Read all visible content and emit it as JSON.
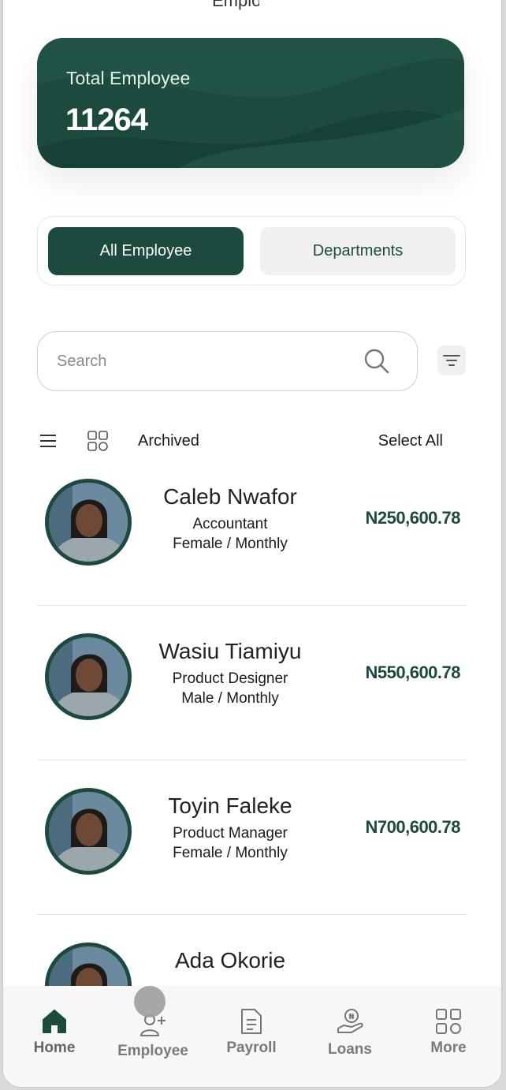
{
  "header": {
    "title_fragment": "Employee"
  },
  "total_card": {
    "label": "Total Employee",
    "value": "11264"
  },
  "tabs": [
    {
      "label": "All Employee",
      "active": true
    },
    {
      "label": "Departments",
      "active": false
    }
  ],
  "search": {
    "placeholder": "Search"
  },
  "view_bar": {
    "archived_label": "Archived",
    "select_all_label": "Select All"
  },
  "employees": [
    {
      "name": "Caleb Nwafor",
      "role": "Accountant",
      "meta": "Female / Monthly",
      "salary": "N250,600.78"
    },
    {
      "name": "Wasiu Tiamiyu",
      "role": "Product Designer",
      "meta": "Male / Monthly",
      "salary": "N550,600.78"
    },
    {
      "name": "Toyin Faleke",
      "role": "Product Manager",
      "meta": "Female / Monthly",
      "salary": "N700,600.78"
    },
    {
      "name": "Ada Okorie",
      "role": "",
      "meta": "",
      "salary": ""
    }
  ],
  "bottom_nav": [
    {
      "label": "Home",
      "icon": "home-icon",
      "active": true
    },
    {
      "label": "Employee",
      "icon": "add-user-icon",
      "active": false
    },
    {
      "label": "Payroll",
      "icon": "document-icon",
      "active": false
    },
    {
      "label": "Loans",
      "icon": "loan-hand-icon",
      "active": false
    },
    {
      "label": "More",
      "icon": "grid-icon",
      "active": false
    }
  ],
  "colors": {
    "brand": "#1c4a3e",
    "tab_inactive_bg": "#f0f0f0",
    "nav_bg": "#f7f7f7",
    "text_muted": "#7a7a7a"
  }
}
